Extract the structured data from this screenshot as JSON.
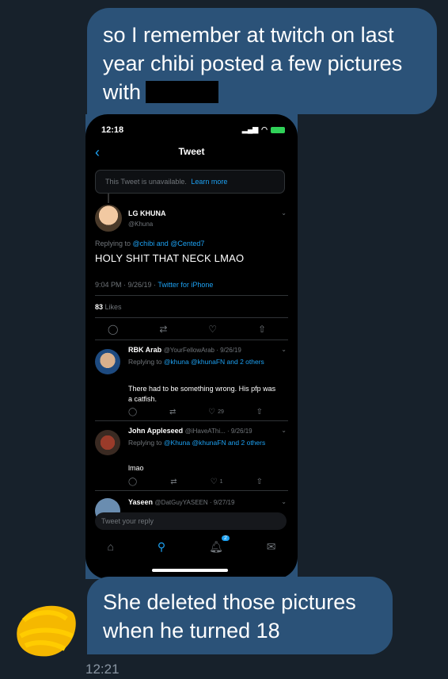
{
  "messages": {
    "top_text": "so I remember at twitch on last year chibi posted a few pictures with",
    "bottom_text": "She deleted those pictures when he turned 18",
    "timestamp": "12:21"
  },
  "colors": {
    "chat_bg": "#17212b",
    "bubble": "#2b5278",
    "twitter_blue": "#1da1f2",
    "redaction": "#000000",
    "scribble": "#f5b800"
  },
  "phone": {
    "status_time": "12:18",
    "nav_title": "Tweet",
    "back_icon": "chevron-left-icon",
    "unavailable_text": "This Tweet is unavailable.",
    "unavailable_link": "Learn more",
    "main_tweet": {
      "name": "LG KHUNA",
      "handle": "@Khuna",
      "reply_prefix": "Replying to",
      "reply_targets": "@chibi and @Cented7",
      "text": "HOLY SHIT THAT NECK LMAO",
      "meta_time": "9:04 PM · 9/26/19 ·",
      "meta_source": "Twitter for iPhone",
      "likes_count": "83",
      "likes_label": "Likes"
    },
    "replies": [
      {
        "name": "RBK Arab",
        "handle_date": "@YourFellowArab · 9/26/19",
        "reply_prefix": "Replying to",
        "reply_targets": "@khuna @khunaFN and 2 others",
        "text": "There had to be something wrong. His pfp was a catfish.",
        "like_count": "29"
      },
      {
        "name": "John Appleseed",
        "handle_date": "@iHaveAThi... · 9/26/19",
        "reply_prefix": "Replying to",
        "reply_targets": "@Khuna @khunaFN and 2 others",
        "text": "lmao",
        "like_count": "1"
      },
      {
        "name": "Yaseen",
        "handle_date": "@DatGuyYASEEN · 9/27/19"
      }
    ],
    "reply_placeholder": "Tweet your reply",
    "notif_badge": "2",
    "tabs": [
      "home-icon",
      "search-icon",
      "notifications-icon",
      "messages-icon"
    ]
  }
}
